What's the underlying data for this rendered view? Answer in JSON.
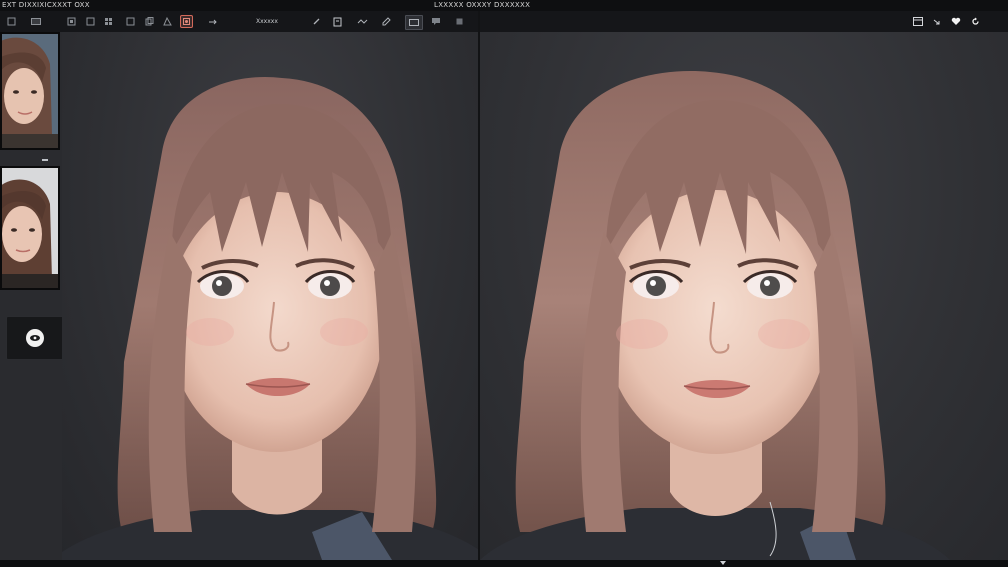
{
  "titlebar": {
    "left_title": "EXT DIXXIXICXXXT OXX",
    "center_title": "LXXXXX OXXXY DXXXXXX"
  },
  "toolbar": {
    "tool_label": "Xxxxxx",
    "left_icons": [
      "square-icon",
      "crop-icon",
      "frame-icon",
      "layers-icon",
      "grid-icon",
      "image-icon",
      "copy-icon",
      "select-icon",
      "record-icon"
    ],
    "right_icons": [
      "window-icon",
      "arrow-icon",
      "heart-icon",
      "refresh-icon"
    ],
    "accent_color": "#d36a5b"
  },
  "sidebar": {
    "thumbnails": [
      {
        "name": "portrait-thumbnail-1"
      },
      {
        "name": "portrait-thumbnail-2"
      }
    ],
    "preview_toggle_icon": "eye-icon"
  },
  "canvas": {
    "panes": [
      "before-view",
      "after-view"
    ],
    "hair_color": "#7a5a55",
    "background_color": "#2f3034"
  }
}
